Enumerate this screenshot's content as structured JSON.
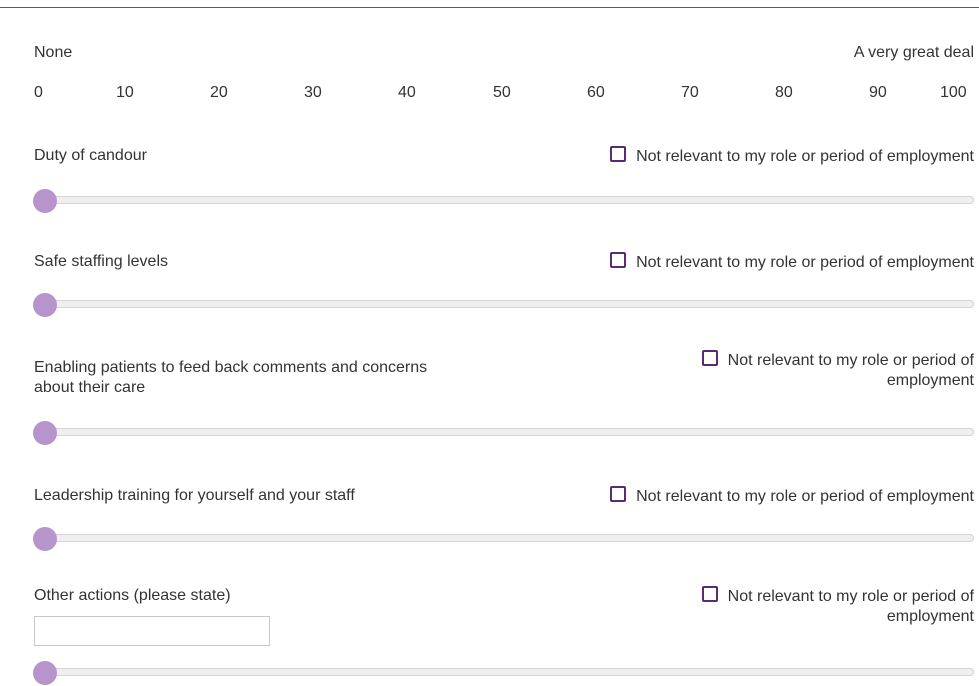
{
  "scale": {
    "low_label": "None",
    "high_label": "A very great deal",
    "ticks": [
      "0",
      "10",
      "20",
      "30",
      "40",
      "50",
      "60",
      "70",
      "80",
      "90",
      "100"
    ]
  },
  "not_relevant_label": "Not relevant to my role or period of employment",
  "not_relevant_label_wrapped": {
    "line1": "Not relevant to my role or period of",
    "line2": "employment"
  },
  "items": [
    {
      "label": "Duty of candour",
      "value": 0,
      "not_relevant": false
    },
    {
      "label": "Safe staffing levels",
      "value": 0,
      "not_relevant": false
    },
    {
      "label_line1": "Enabling patients to feed back comments and concerns",
      "label_line2": "about their care",
      "value": 0,
      "not_relevant": false
    },
    {
      "label": "Leadership training for yourself and your staff",
      "value": 0,
      "not_relevant": false
    },
    {
      "label": "Other actions (please state)",
      "input_value": "",
      "value": 0,
      "not_relevant": false
    }
  ],
  "colors": {
    "accent": "#7b3f99",
    "thumb": "#b894cc",
    "checkbox_border": "#5b2a73",
    "track": "#efefef"
  }
}
